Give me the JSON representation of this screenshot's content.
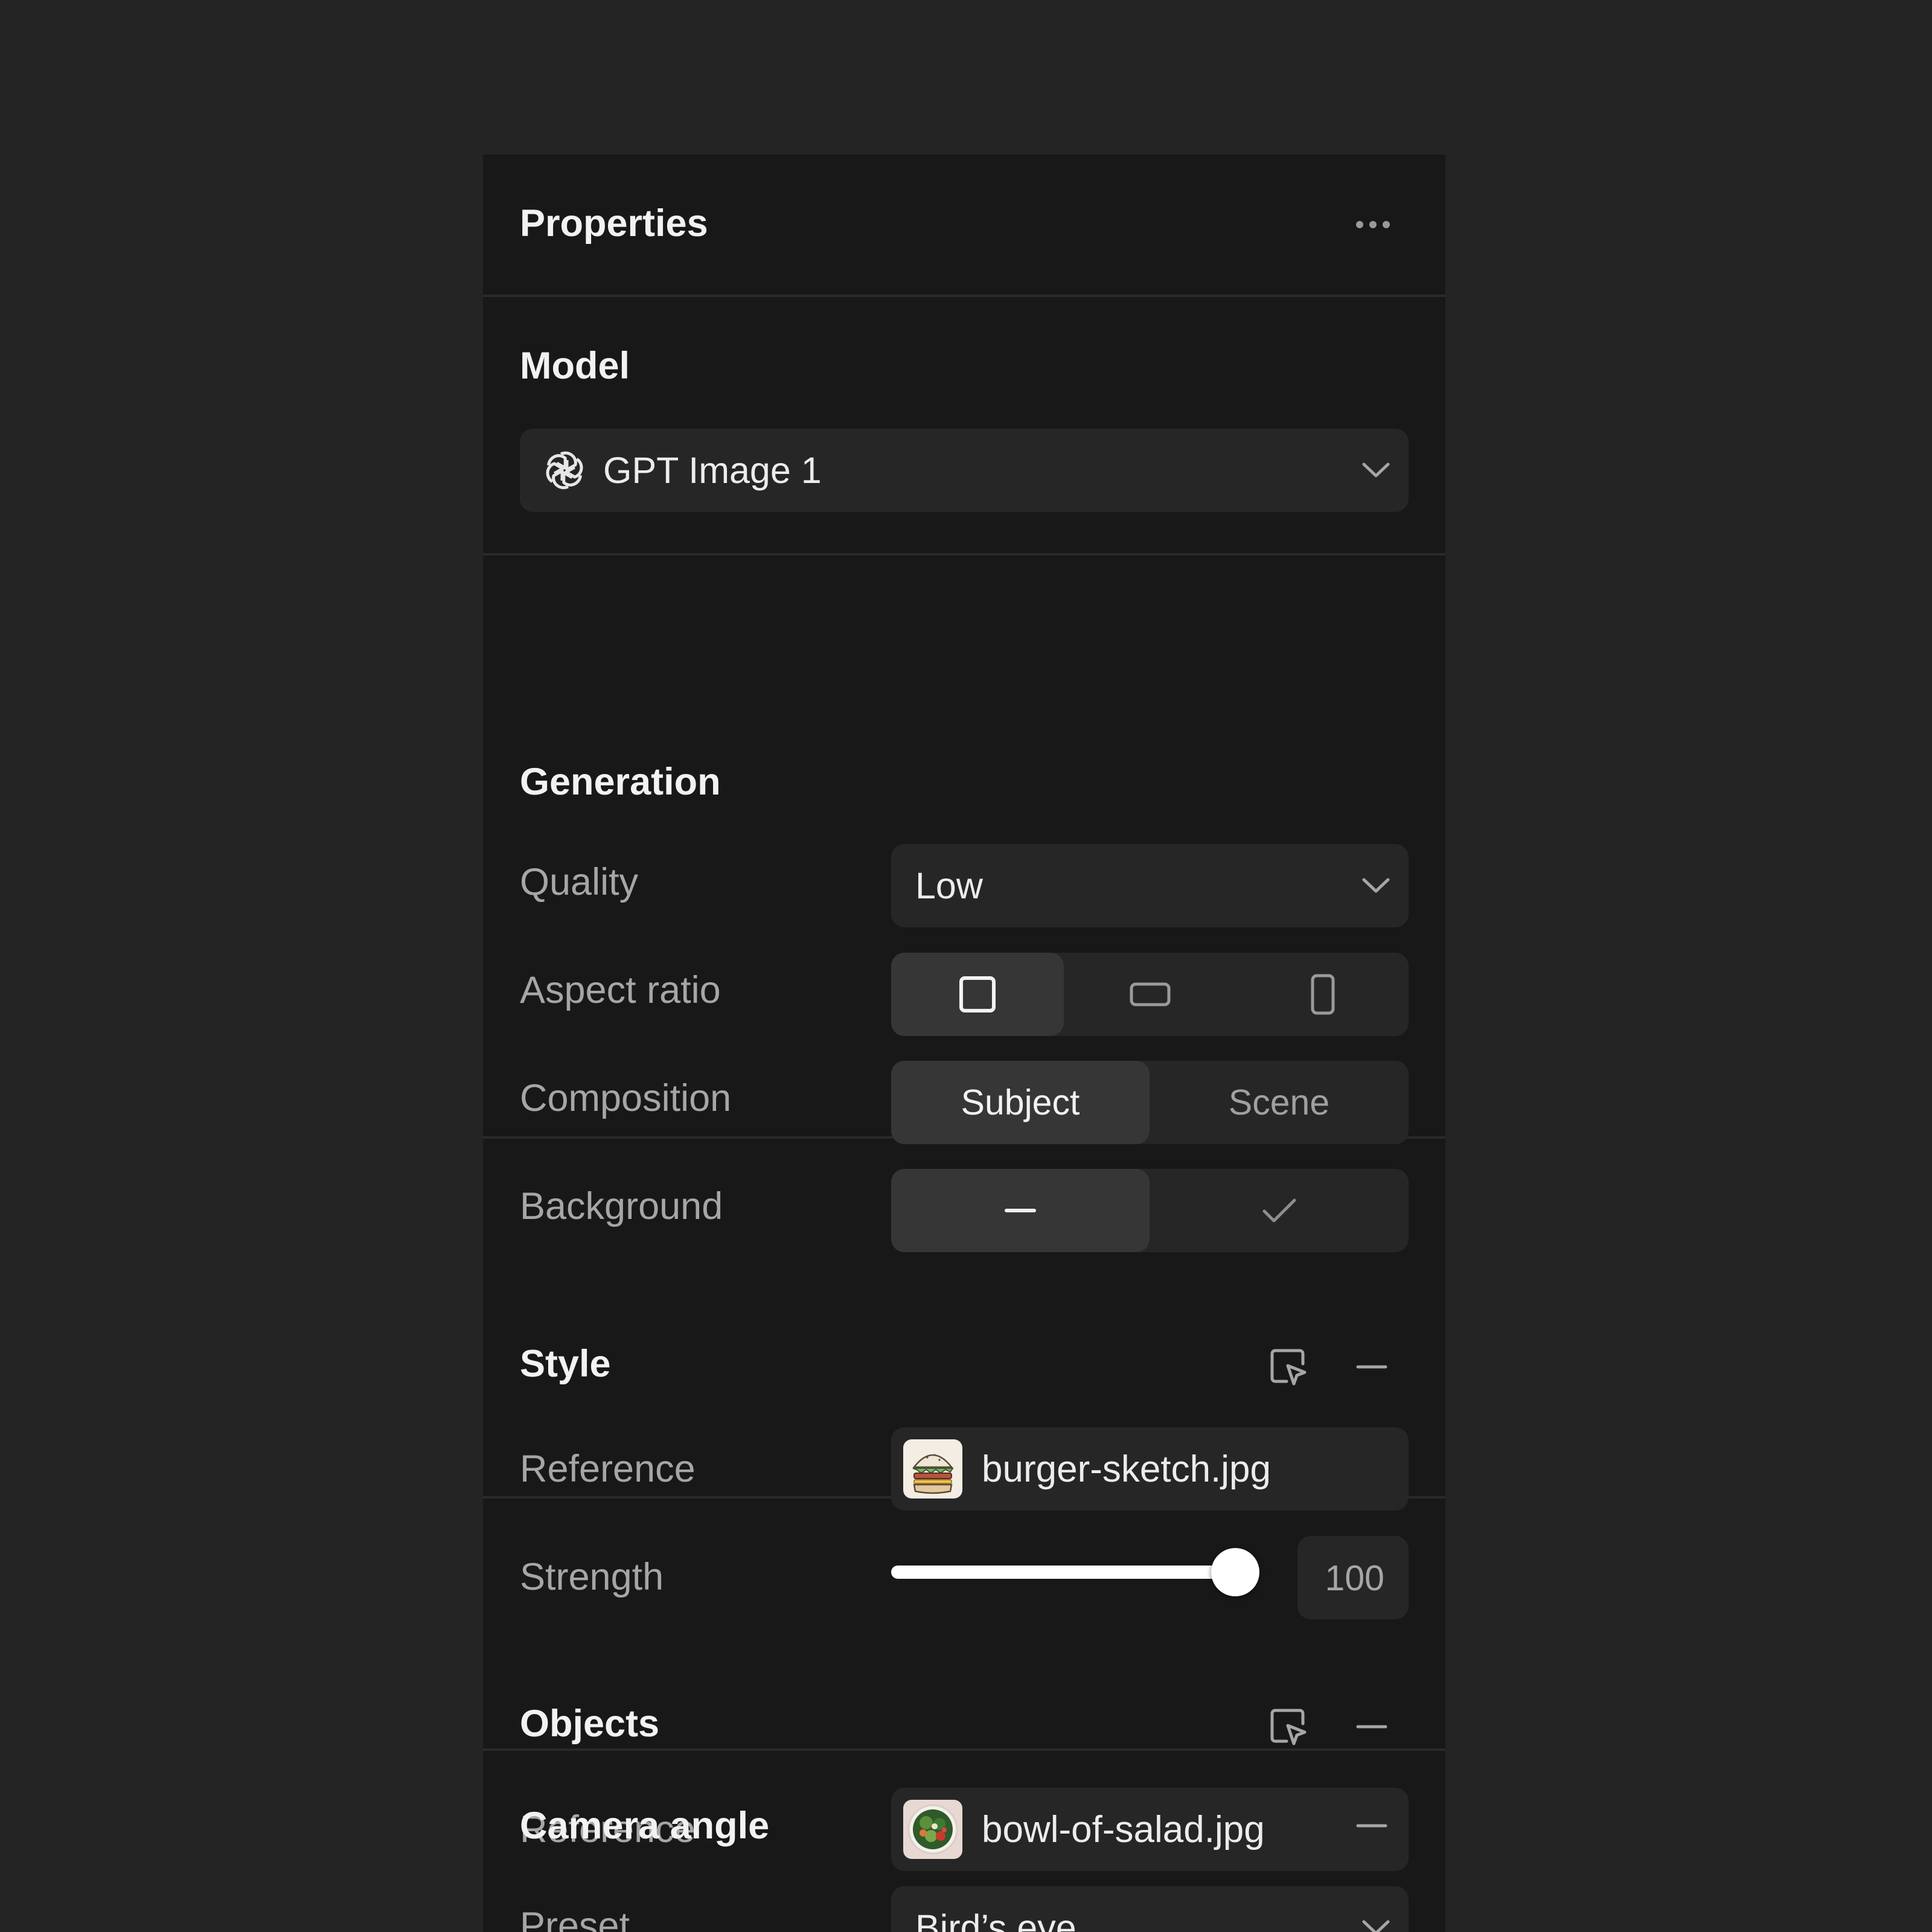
{
  "panel": {
    "title": "Properties"
  },
  "model": {
    "section_title": "Model",
    "selected": "GPT Image 1",
    "icon": "openai-logo-icon"
  },
  "generation": {
    "section_title": "Generation",
    "quality": {
      "label": "Quality",
      "value": "Low"
    },
    "aspect_ratio": {
      "label": "Aspect ratio",
      "options": [
        "square",
        "landscape",
        "portrait"
      ],
      "selected": "square"
    },
    "composition": {
      "label": "Composition",
      "options": [
        "Subject",
        "Scene"
      ],
      "selected": "Subject"
    },
    "background": {
      "label": "Background",
      "options": [
        "off",
        "on"
      ],
      "selected": "off"
    }
  },
  "style": {
    "section_title": "Style",
    "reference": {
      "label": "Reference",
      "file": "burger-sketch.jpg"
    },
    "strength": {
      "label": "Strength",
      "value": "100",
      "fraction": 1.0
    }
  },
  "objects": {
    "section_title": "Objects",
    "reference": {
      "label": "Reference",
      "file": "bowl-of-salad.jpg"
    }
  },
  "camera": {
    "section_title": "Camera angle",
    "preset": {
      "label": "Preset",
      "value": "Bird’s eye"
    }
  },
  "colors": {
    "page_bg": "#242424",
    "panel_bg": "#181818",
    "control_bg": "#262626",
    "active_seg": "#363636",
    "text_primary": "#f2f2f2",
    "text_secondary": "#a6a6a6"
  }
}
